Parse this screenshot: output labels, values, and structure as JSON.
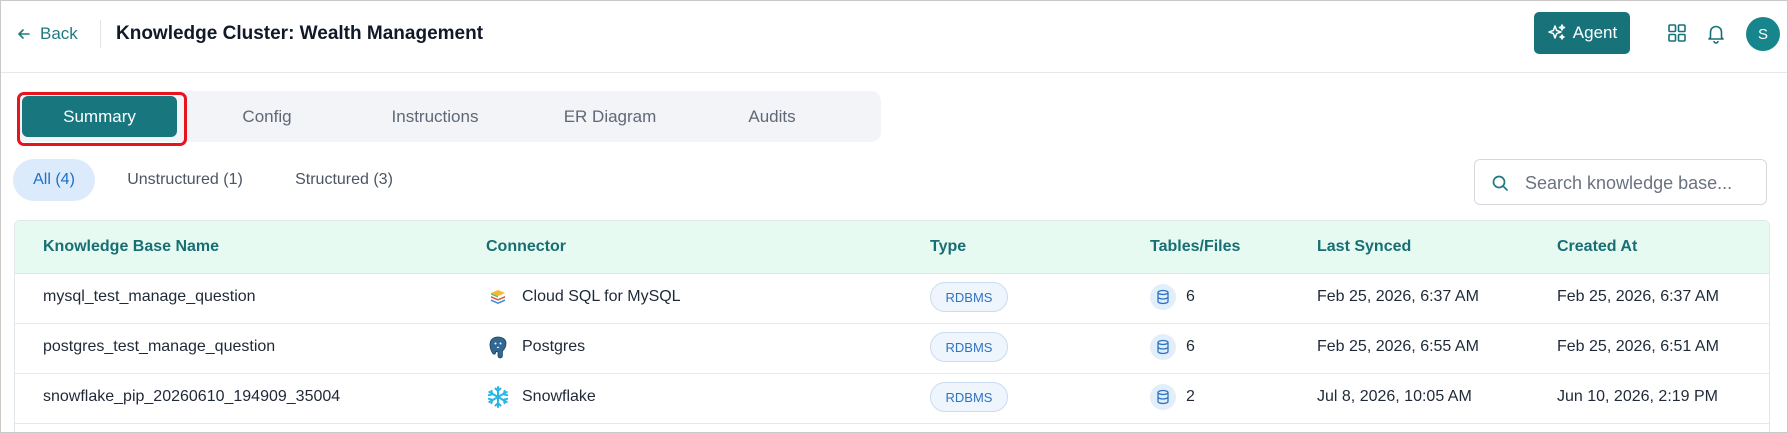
{
  "header": {
    "back_label": "Back",
    "title": "Knowledge Cluster: Wealth Management",
    "agent_label": "Agent",
    "avatar_initial": "S"
  },
  "tabs": [
    {
      "label": "Summary",
      "active": true
    },
    {
      "label": "Config",
      "active": false
    },
    {
      "label": "Instructions",
      "active": false
    },
    {
      "label": "ER Diagram",
      "active": false
    },
    {
      "label": "Audits",
      "active": false
    }
  ],
  "filters": [
    {
      "label": "All (4)",
      "active": true
    },
    {
      "label": "Unstructured (1)",
      "active": false
    },
    {
      "label": "Structured (3)",
      "active": false
    }
  ],
  "search": {
    "placeholder": "Search knowledge base...",
    "value": ""
  },
  "table": {
    "columns": [
      "Knowledge Base Name",
      "Connector",
      "Type",
      "Tables/Files",
      "Last Synced",
      "Created At"
    ],
    "rows": [
      {
        "name": "mysql_test_manage_question",
        "connector": "Cloud SQL for MySQL",
        "connector_icon": "cloud-sql-icon",
        "type": "RDBMS",
        "tables": "6",
        "last_synced": "Feb 25, 2026, 6:37 AM",
        "created_at": "Feb 25, 2026, 6:37 AM"
      },
      {
        "name": "postgres_test_manage_question",
        "connector": "Postgres",
        "connector_icon": "postgres-icon",
        "type": "RDBMS",
        "tables": "6",
        "last_synced": "Feb 25, 2026, 6:55 AM",
        "created_at": "Feb 25, 2026, 6:51 AM"
      },
      {
        "name": "snowflake_pip_20260610_194909_35004",
        "connector": "Snowflake",
        "connector_icon": "snowflake-icon",
        "type": "RDBMS",
        "tables": "2",
        "last_synced": "Jul 8, 2026, 10:05 AM",
        "created_at": "Jun 10, 2026, 2:19 PM"
      }
    ]
  },
  "colors": {
    "brand": "#17727a",
    "highlight": "#e8141d",
    "header_bg": "#e7faf1",
    "badge_text": "#2e74c4"
  }
}
